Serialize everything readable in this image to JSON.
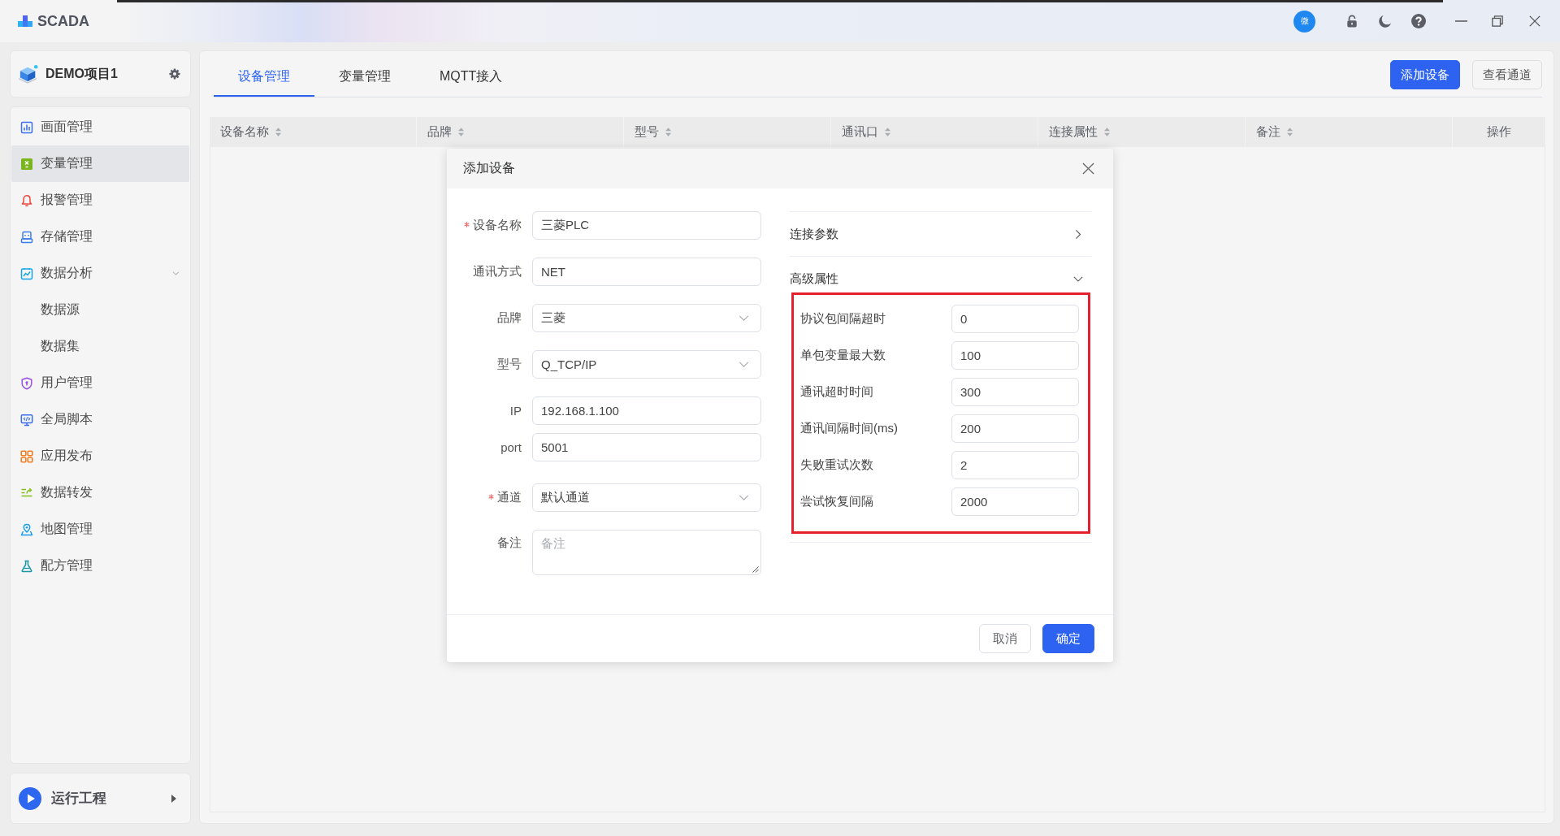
{
  "titlebar": {
    "app_name": "SCADA",
    "avatar_text": "微"
  },
  "project": {
    "name": "DEMO项目1"
  },
  "sidebar": {
    "items": [
      {
        "label": "画面管理",
        "selected": false
      },
      {
        "label": "变量管理",
        "selected": true
      },
      {
        "label": "报警管理",
        "selected": false
      },
      {
        "label": "存储管理",
        "selected": false
      },
      {
        "label": "数据分析",
        "selected": false,
        "expanded": true,
        "children": [
          {
            "label": "数据源",
            "selected": false
          },
          {
            "label": "数据集",
            "selected": false
          }
        ]
      },
      {
        "label": "用户管理",
        "selected": false
      },
      {
        "label": "全局脚本",
        "selected": false
      },
      {
        "label": "应用发布",
        "selected": false
      },
      {
        "label": "数据转发",
        "selected": false
      },
      {
        "label": "地图管理",
        "selected": false
      },
      {
        "label": "配方管理",
        "selected": false
      }
    ]
  },
  "run_button": {
    "label": "运行工程"
  },
  "tabs": [
    {
      "label": "设备管理",
      "selected": true
    },
    {
      "label": "变量管理",
      "selected": false
    },
    {
      "label": "MQTT接入",
      "selected": false
    }
  ],
  "toolbar_buttons": [
    {
      "label": "添加设备",
      "kind": "primary"
    },
    {
      "label": "查看通道",
      "kind": "default"
    }
  ],
  "table": {
    "columns": [
      {
        "label": "设备名称",
        "sortable": true
      },
      {
        "label": "品牌",
        "sortable": true
      },
      {
        "label": "型号",
        "sortable": true
      },
      {
        "label": "通讯口",
        "sortable": true
      },
      {
        "label": "连接属性",
        "sortable": true
      },
      {
        "label": "备注",
        "sortable": true
      },
      {
        "label": "操作",
        "sortable": false
      }
    ]
  },
  "dialog": {
    "title": "添加设备",
    "form": {
      "fields": [
        {
          "kind": "input",
          "label": "设备名称",
          "required": true,
          "value": "三菱PLC"
        },
        {
          "kind": "input",
          "label": "通讯方式",
          "required": false,
          "value": "NET"
        },
        {
          "kind": "select",
          "label": "品牌",
          "required": false,
          "value": "三菱"
        },
        {
          "kind": "select",
          "label": "型号",
          "required": false,
          "value": "Q_TCP/IP"
        },
        {
          "kind": "group",
          "fields": [
            {
              "kind": "input",
              "label": "IP",
              "required": false,
              "value": "192.168.1.100"
            },
            {
              "kind": "input",
              "label": "port",
              "required": false,
              "value": "5001"
            }
          ]
        },
        {
          "kind": "select",
          "label": "通道",
          "required": true,
          "value": "默认通道"
        },
        {
          "kind": "textarea",
          "label": "备注",
          "required": false,
          "placeholder": "备注"
        }
      ]
    },
    "sections": [
      {
        "title": "连接参数",
        "expanded": false
      },
      {
        "title": "高级属性",
        "expanded": true,
        "highlighted": true,
        "fields": [
          {
            "label": "协议包间隔超时",
            "value": "0"
          },
          {
            "label": "单包变量最大数",
            "value": "100"
          },
          {
            "label": "通讯超时时间",
            "value": "300"
          },
          {
            "label": "通讯间隔时间(ms)",
            "value": "200"
          },
          {
            "label": "失败重试次数",
            "value": "2"
          },
          {
            "label": "尝试恢复间隔",
            "value": "2000"
          }
        ]
      }
    ],
    "buttons": [
      {
        "label": "取消",
        "kind": "default"
      },
      {
        "label": "确定",
        "kind": "primary"
      }
    ]
  }
}
